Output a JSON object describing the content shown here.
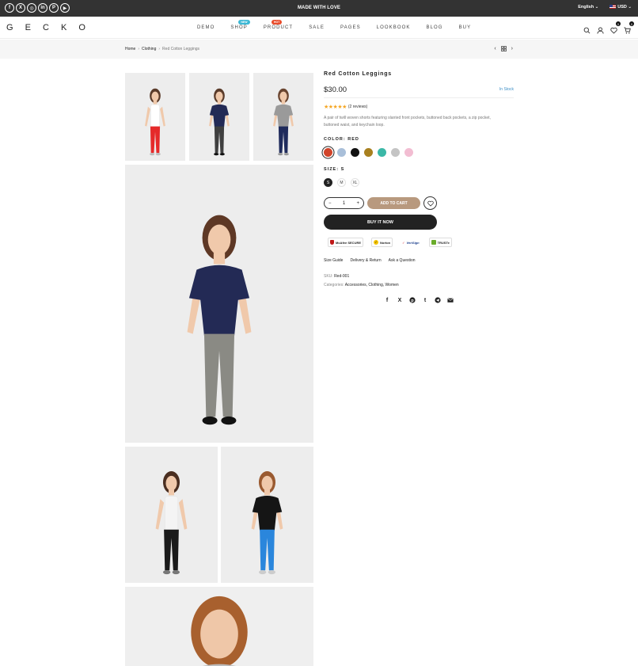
{
  "topbar": {
    "social": [
      {
        "icon": "facebook-icon",
        "glyph": "f"
      },
      {
        "icon": "x-twitter-icon",
        "glyph": "X"
      },
      {
        "icon": "instagram-icon",
        "glyph": "◎"
      },
      {
        "icon": "linkedin-icon",
        "glyph": "in"
      },
      {
        "icon": "pinterest-icon",
        "glyph": "P"
      },
      {
        "icon": "youtube-icon",
        "glyph": "▶"
      }
    ],
    "message": "MADE WITH LOVE",
    "language": "English",
    "currency": "USD"
  },
  "header": {
    "logo": "G E C K O",
    "nav": [
      {
        "label": "DEMO",
        "badge": "",
        "badge_color": ""
      },
      {
        "label": "SHOP",
        "badge": "NEW",
        "badge_color": "#3cb8d5"
      },
      {
        "label": "PRODUCT",
        "badge": "HOT",
        "badge_color": "#e84c2b"
      },
      {
        "label": "SALE",
        "badge": "",
        "badge_color": ""
      },
      {
        "label": "PAGES",
        "badge": "",
        "badge_color": ""
      },
      {
        "label": "LOOKBOOK",
        "badge": "",
        "badge_color": ""
      },
      {
        "label": "BLOG",
        "badge": "",
        "badge_color": ""
      },
      {
        "label": "BUY",
        "badge": "",
        "badge_color": ""
      }
    ],
    "wishlist_count": "0",
    "cart_count": "0"
  },
  "breadcrumb": {
    "home": "Home",
    "category": "Clothing",
    "current": "Red Cotton Leggings"
  },
  "product": {
    "title": "Red Cotton Leggings",
    "price": "$30.00",
    "stock": "In Stock",
    "rating": 5,
    "reviews": "(2 reviews)",
    "description": "A pair of twill woven shorts featuring slanted front pockets, buttoned back pockets, a zip pocket, buttoned waist, and keychain loop.",
    "color_label": "COLOR: RED",
    "colors": [
      "#d1442a",
      "#a9bfd9",
      "#111111",
      "#a8801f",
      "#3bb8a7",
      "#c4c4c4",
      "#f2bdd2"
    ],
    "selected_color": 0,
    "size_label": "SIZE: S",
    "sizes": [
      "S",
      "M",
      "XL"
    ],
    "selected_size": 0,
    "quantity": "1",
    "add_to_cart": "ADD TO CART",
    "buy_now": "BUY IT NOW",
    "trust_badges": [
      "McAfee SECURE",
      "Norton",
      "VeriSign",
      "TRUSTe"
    ],
    "links": [
      "Size Guide",
      "Delivery & Return",
      "Ask a Question"
    ],
    "sku_label": "SKU:",
    "sku": "Red-001",
    "categories_label": "Categories:",
    "categories": "Accessories, Clothing, Women",
    "share": [
      "facebook-icon",
      "x-twitter-icon",
      "pinterest-icon",
      "tumblr-icon",
      "telegram-icon",
      "email-icon"
    ]
  },
  "gallery": [
    {
      "name": "photo-white-tank-red-leggings",
      "top": "#ffffff",
      "sleeve": "tank",
      "legs": "#e52a2a",
      "hair": "#5a3b2a",
      "shoes": "#bbbbbb"
    },
    {
      "name": "photo-navy-tee-gray-leggings",
      "top": "#232a55",
      "sleeve": "short",
      "legs": "#3f3f3f",
      "hair": "#5a3b2a",
      "shoes": "#111111"
    },
    {
      "name": "photo-gray-tee-navy-leggings",
      "top": "#9a9a9a",
      "sleeve": "short",
      "legs": "#1f2b5c",
      "hair": "#6a4530",
      "shoes": "#999999"
    },
    {
      "name": "photo-main-navy-tee-gray-leggings",
      "top": "#232a55",
      "sleeve": "short",
      "legs": "#8a8a84",
      "hair": "#5e3825",
      "shoes": "#111111"
    },
    {
      "name": "photo-white-tank-black-leggings",
      "top": "#f4f4f4",
      "sleeve": "tank",
      "legs": "#1a1a1a",
      "hair": "#4a2e20",
      "shoes": "#777777"
    },
    {
      "name": "photo-black-tee-blue-leggings",
      "top": "#151515",
      "sleeve": "short",
      "legs": "#2a86dc",
      "hair": "#9a5a30",
      "shoes": "#cccccc"
    },
    {
      "name": "photo-gray-tee-closeup",
      "top": "#bcbcbc",
      "sleeve": "short",
      "legs": "#888888",
      "hair": "#a8602e",
      "shoes": "#999999",
      "closeup": true
    }
  ]
}
